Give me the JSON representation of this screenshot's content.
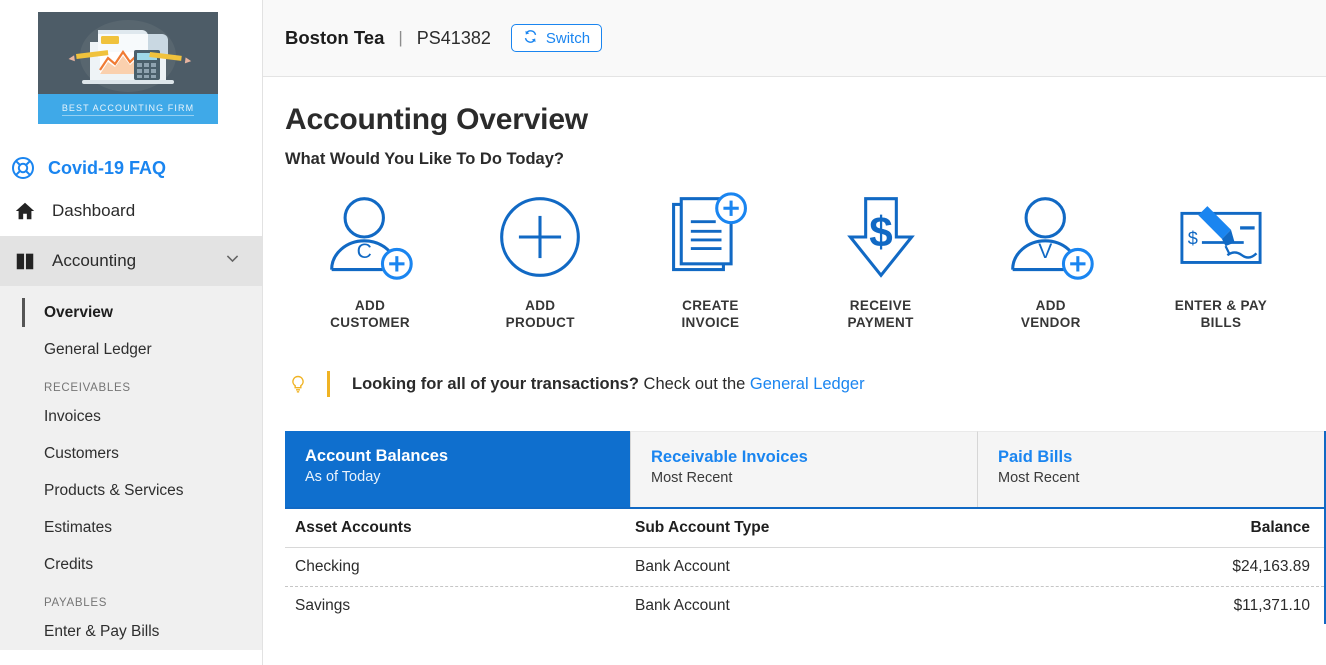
{
  "sidebar": {
    "logo": {
      "banner_text": "BEST ACCOUNTING FIRM"
    },
    "covid_link": {
      "label": "Covid-19 FAQ",
      "icon": "lifebuoy-icon"
    },
    "nav": [
      {
        "label": "Dashboard",
        "icon": "home-icon"
      },
      {
        "label": "Accounting",
        "icon": "book-icon",
        "expanded": true,
        "chevron": "chevron-down-icon"
      }
    ],
    "submenu": [
      {
        "label": "Overview",
        "current": true
      },
      {
        "label": "General Ledger",
        "current": false
      }
    ],
    "group_receivables": {
      "heading": "RECEIVABLES",
      "items": [
        {
          "label": "Invoices"
        },
        {
          "label": "Customers"
        },
        {
          "label": "Products & Services"
        },
        {
          "label": "Estimates"
        },
        {
          "label": "Credits"
        }
      ]
    },
    "group_payables": {
      "heading": "PAYABLES",
      "items": [
        {
          "label": "Enter & Pay Bills"
        }
      ]
    }
  },
  "topbar": {
    "company": "Boston Tea",
    "separator": "|",
    "account_id": "PS41382",
    "switch_button": {
      "label": "Switch",
      "icon": "sync-icon"
    }
  },
  "page": {
    "title": "Accounting Overview",
    "subtitle": "What Would You Like To Do Today?"
  },
  "actions": [
    {
      "line1": "ADD",
      "line2": "CUSTOMER",
      "icon": "add-customer-icon",
      "badge_letter": "C"
    },
    {
      "line1": "ADD",
      "line2": "PRODUCT",
      "icon": "add-product-icon"
    },
    {
      "line1": "CREATE",
      "line2": "INVOICE",
      "icon": "create-invoice-icon"
    },
    {
      "line1": "RECEIVE",
      "line2": "PAYMENT",
      "icon": "receive-payment-icon"
    },
    {
      "line1": "ADD",
      "line2": "VENDOR",
      "icon": "add-vendor-icon",
      "badge_letter": "V"
    },
    {
      "line1": "ENTER & PAY",
      "line2": "BILLS",
      "icon": "enter-pay-bills-icon"
    }
  ],
  "tip": {
    "icon": "lightbulb-icon",
    "bold_text": "Looking for all of your transactions?",
    "text": " Check out the ",
    "link_text": "General Ledger"
  },
  "tabs": [
    {
      "title": "Account Balances",
      "subtitle": "As of Today",
      "active": true
    },
    {
      "title": "Receivable Invoices",
      "subtitle": "Most Recent",
      "active": false
    },
    {
      "title": "Paid Bills",
      "subtitle": "Most Recent",
      "active": false
    }
  ],
  "table": {
    "headers": [
      "Asset Accounts",
      "Sub Account Type",
      "Balance"
    ],
    "rows": [
      {
        "account": "Checking",
        "sub_type": "Bank Account",
        "balance": "$24,163.89"
      },
      {
        "account": "Savings",
        "sub_type": "Bank Account",
        "balance": "$11,371.10"
      }
    ]
  },
  "colors": {
    "accent_blue": "#1a85f0",
    "tab_active_blue": "#0f6fce",
    "border_blue": "#1169c4",
    "tip_gold": "#f0b323",
    "logo_dark": "#4d5c67",
    "logo_blue": "#3fa9e8"
  }
}
